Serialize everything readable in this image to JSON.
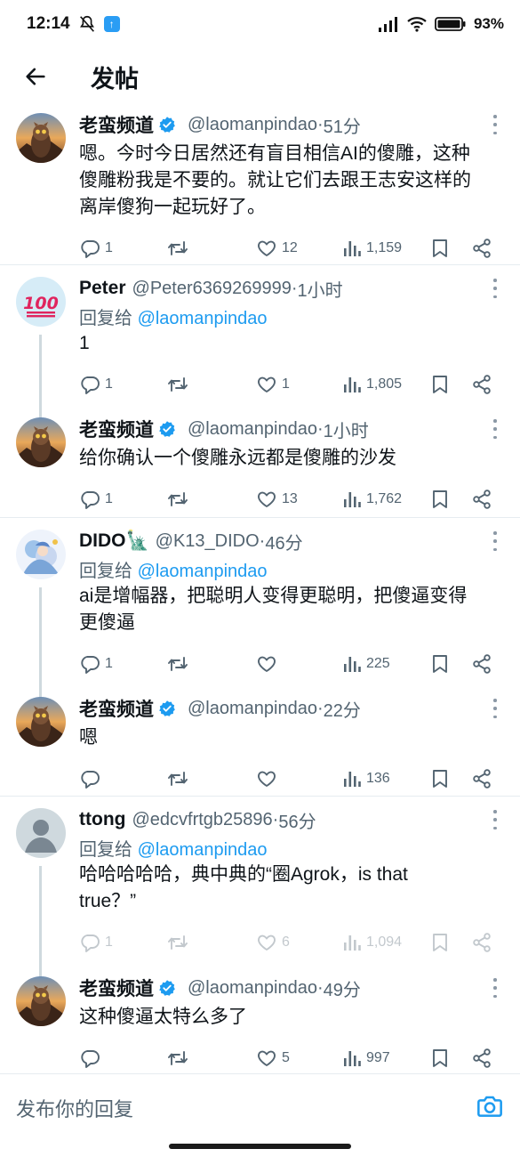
{
  "status_bar": {
    "time": "12:14",
    "battery": "93%"
  },
  "header": {
    "title": "发帖"
  },
  "tweets": [
    {
      "name": "老蛮频道",
      "handle": "@laomanpindao",
      "sep": " · ",
      "time": "51分",
      "verified": true,
      "reply_prefix": "",
      "reply_handle": "",
      "lines": [
        "嗯。今时今日居然还有盲目相信AI的傻雕，这种",
        "傻雕粉我是不要的。就让它们去跟王志安这样的",
        "离岸傻狗一起玩好了。"
      ],
      "replies": "1",
      "reposts": "",
      "likes": "12",
      "views": "1,159"
    },
    {
      "name": "Peter",
      "handle": "@Peter6369269999",
      "sep": " · ",
      "time": "1小时",
      "verified": false,
      "reply_prefix": "回复给 ",
      "reply_handle": "@laomanpindao",
      "lines": [
        "1"
      ],
      "replies": "1",
      "reposts": "",
      "likes": "1",
      "views": "1,805"
    },
    {
      "name": "老蛮频道",
      "handle": "@laomanpindao",
      "sep": " · ",
      "time": "1小时",
      "verified": true,
      "reply_prefix": "",
      "reply_handle": "",
      "lines": [
        "给你确认一个傻雕永远都是傻雕的沙发"
      ],
      "replies": "1",
      "reposts": "",
      "likes": "13",
      "views": "1,762"
    },
    {
      "name": "DIDO🗽",
      "handle": "@K13_DIDO",
      "sep": " · ",
      "time": "46分",
      "verified": false,
      "reply_prefix": "回复给 ",
      "reply_handle": "@laomanpindao",
      "lines": [
        "ai是增幅器，把聪明人变得更聪明，把傻逼变得",
        "更傻逼"
      ],
      "replies": "1",
      "reposts": "",
      "likes": "",
      "views": "225"
    },
    {
      "name": "老蛮频道",
      "handle": "@laomanpindao",
      "sep": " · ",
      "time": "22分",
      "verified": true,
      "reply_prefix": "",
      "reply_handle": "",
      "lines": [
        "嗯"
      ],
      "replies": "",
      "reposts": "",
      "likes": "",
      "views": "136"
    },
    {
      "name": "ttong",
      "handle": "@edcvfrtgb25896",
      "sep": " · ",
      "time": "56分",
      "verified": false,
      "reply_prefix": "回复给 ",
      "reply_handle": "@laomanpindao",
      "lines": [
        "哈哈哈哈哈，典中典的“圈Agrok，is that",
        "true？”"
      ],
      "replies": "1",
      "reposts": "",
      "likes": "6",
      "views": "1,094"
    },
    {
      "name": "老蛮频道",
      "handle": "@laomanpindao",
      "sep": " · ",
      "time": "49分",
      "verified": true,
      "reply_prefix": "",
      "reply_handle": "",
      "lines": [
        "这种傻逼太特么多了"
      ],
      "replies": "",
      "reposts": "",
      "likes": "5",
      "views": "997"
    }
  ],
  "composer": {
    "placeholder": "发布你的回复"
  },
  "colors": {
    "accent": "#1d9bf0",
    "text": "#0f1419",
    "secondary": "#536471",
    "divider": "#e6ecf0"
  },
  "icons": [
    "arrow-left-icon",
    "verified-badge-icon",
    "more-vertical-icon",
    "reply-icon",
    "repost-icon",
    "like-icon",
    "views-icon",
    "bookmark-icon",
    "share-icon",
    "camera-icon"
  ]
}
